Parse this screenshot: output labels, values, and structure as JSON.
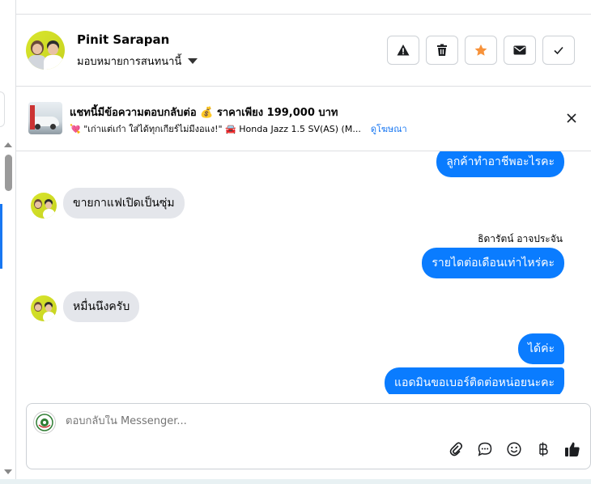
{
  "header": {
    "name": "Pinit Sarapan",
    "assign_label": "มอบหมายการสนทนานี้",
    "buttons": [
      {
        "icon": "warning-icon"
      },
      {
        "icon": "trash-icon"
      },
      {
        "icon": "star-icon",
        "color": "#f7923a"
      },
      {
        "icon": "mail-icon"
      },
      {
        "icon": "check-icon"
      }
    ]
  },
  "ad": {
    "title": "แชทนี้มีข้อความตอบกลับต่อ 💰 ราคาเพียง 199,000 บาท",
    "subtitle": "💘 \"เก่าแต่เก๋า ใส่ได้ทุกเกียร์ไม่มีงอแง!\" 🚘 Honda Jazz 1.5 SV(AS) (M...",
    "link": "ดูโฆษณา"
  },
  "messages": [
    {
      "direction": "out",
      "text": "ลูกค้าทำอาชีพอะไรคะ"
    },
    {
      "direction": "in",
      "text": "ขายกาแฟเปิดเป็นซุ่ม"
    },
    {
      "direction": "out",
      "sender": "ธิดารัตน์ อาจประจัน",
      "text": "รายไดต่อเดือนเท่าไหร่คะ"
    },
    {
      "direction": "in",
      "text": "หมื่นนึงครับ"
    },
    {
      "direction": "out",
      "text": "ได้ค่ะ"
    },
    {
      "direction": "out",
      "text": "แอดมินขอเบอร์ติดต่อหน่อยนะคะ"
    }
  ],
  "composer": {
    "placeholder": "ตอบกลับใน Messenger...",
    "tools": [
      "attachment-icon",
      "chat-bubble-icon",
      "emoji-icon",
      "baht-icon",
      "thumbs-up-icon"
    ]
  },
  "colors": {
    "outgoing_bubble": "#0a7cff",
    "incoming_bubble": "#e4e6eb",
    "accent": "#1877f2"
  }
}
